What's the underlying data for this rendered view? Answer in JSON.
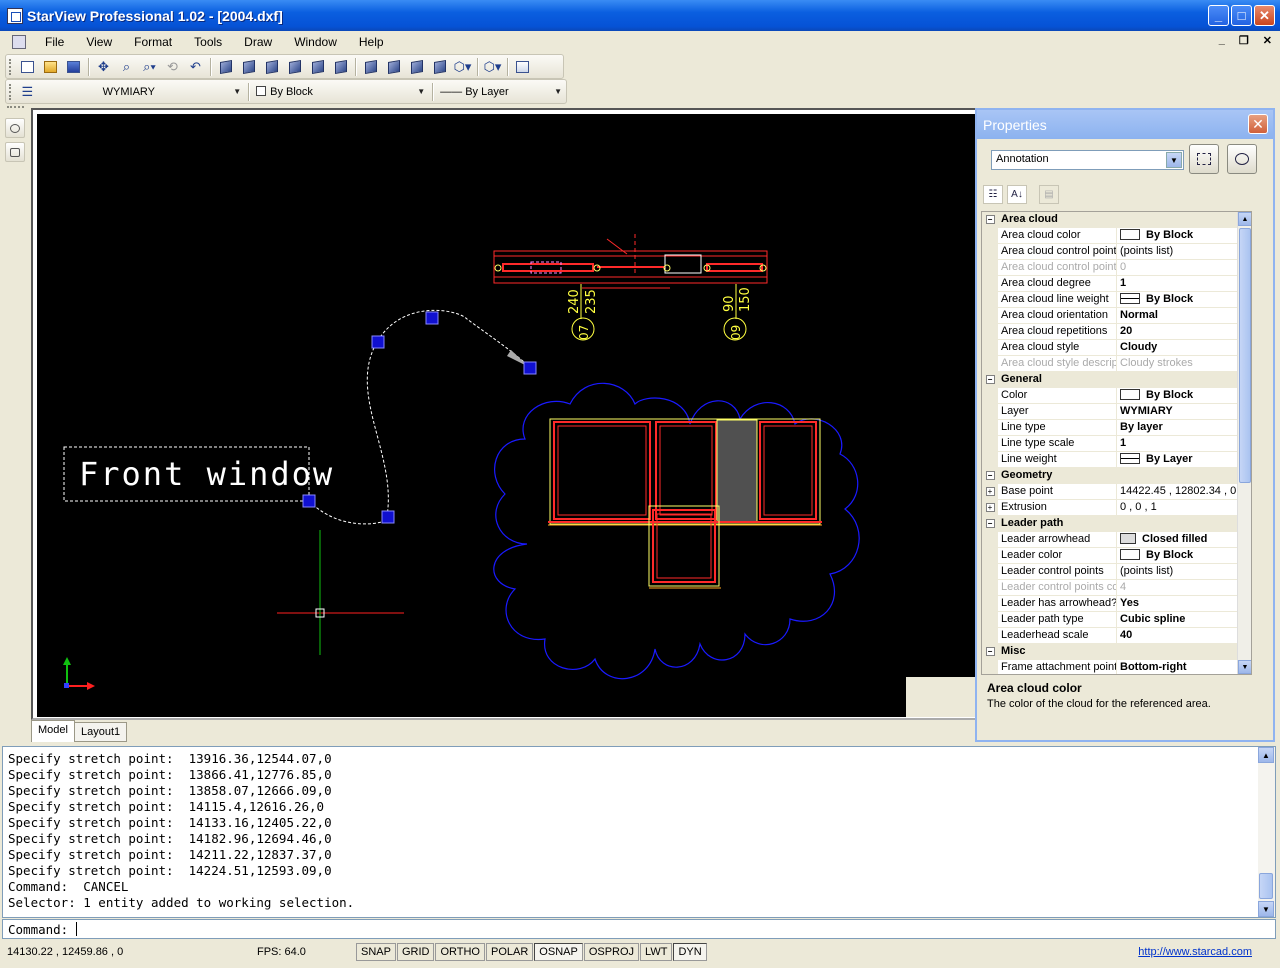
{
  "window": {
    "title": "StarView Professional 1.02 - [2004.dxf]",
    "minimize": "_",
    "maximize": "□",
    "close": "✕",
    "mdi_minimize": "_",
    "mdi_restore": "❐",
    "mdi_close": "✕"
  },
  "menu": [
    "File",
    "View",
    "Format",
    "Tools",
    "Draw",
    "Window",
    "Help"
  ],
  "toolbar2": {
    "layer": "WYMIARY",
    "color": "By Block",
    "linetype": "—— By Layer"
  },
  "canvas": {
    "annotation_text": "Front window",
    "dim_labels": [
      "240",
      "235",
      "07",
      "90",
      "150",
      "09"
    ],
    "colors": {
      "background": "#000000",
      "cloud": "#1a1aff",
      "leader": "#ffffff",
      "grips": "#1010d0",
      "dimension": "#ffff40",
      "window_frame": "#ff2a2a",
      "window_outline": "#ffff66"
    }
  },
  "tabs": [
    "Model",
    "Layout1"
  ],
  "properties": {
    "title": "Properties",
    "selector": "Annotation",
    "categories": [
      {
        "name": "Area cloud",
        "rows": [
          {
            "name": "Area cloud color",
            "value": "By Block",
            "bold": true,
            "swatch": "color"
          },
          {
            "name": "Area cloud control points",
            "value": "(points list)"
          },
          {
            "name": "Area cloud control points",
            "value": "0",
            "disabled": true
          },
          {
            "name": "Area cloud degree",
            "value": "1",
            "bold": true
          },
          {
            "name": "Area cloud line weight",
            "value": "By Block",
            "bold": true,
            "swatch": "lw"
          },
          {
            "name": "Area cloud orientation",
            "value": "Normal",
            "bold": true
          },
          {
            "name": "Area cloud repetitions",
            "value": "20",
            "bold": true
          },
          {
            "name": "Area cloud style",
            "value": "Cloudy",
            "bold": true
          },
          {
            "name": "Area cloud style descript",
            "value": "Cloudy strokes",
            "disabled": true
          }
        ]
      },
      {
        "name": "General",
        "rows": [
          {
            "name": "Color",
            "value": "By Block",
            "bold": true,
            "swatch": "color"
          },
          {
            "name": "Layer",
            "value": "WYMIARY",
            "bold": true
          },
          {
            "name": "Line type",
            "value": "By layer",
            "bold": true
          },
          {
            "name": "Line type scale",
            "value": "1",
            "bold": true
          },
          {
            "name": "Line weight",
            "value": "By Layer",
            "bold": true,
            "swatch": "lw"
          }
        ]
      },
      {
        "name": "Geometry",
        "rows": [
          {
            "name": "Base point",
            "value": "14422.45 , 12802.34 , 0",
            "expand": true
          },
          {
            "name": "Extrusion",
            "value": "0 , 0 , 1",
            "expand": true
          }
        ]
      },
      {
        "name": "Leader path",
        "rows": [
          {
            "name": "Leader arrowhead",
            "value": "Closed filled",
            "bold": true,
            "swatch": "arrow"
          },
          {
            "name": "Leader color",
            "value": "By Block",
            "bold": true,
            "swatch": "color"
          },
          {
            "name": "Leader control points",
            "value": "(points list)"
          },
          {
            "name": "Leader control points cou",
            "value": "4",
            "disabled": true
          },
          {
            "name": "Leader has arrowhead?",
            "value": "Yes",
            "bold": true
          },
          {
            "name": "Leader path type",
            "value": "Cubic spline",
            "bold": true
          },
          {
            "name": "Leaderhead scale",
            "value": "40",
            "bold": true
          }
        ]
      },
      {
        "name": "Misc",
        "rows": [
          {
            "name": "Frame attachment point",
            "value": "Bottom-right",
            "bold": true
          }
        ]
      }
    ],
    "description_title": "Area cloud color",
    "description_text": "The color of the cloud for the referenced area."
  },
  "history": [
    "Specify stretch point:  13916.36,12544.07,0",
    "Specify stretch point:  13866.41,12776.85,0",
    "Specify stretch point:  13858.07,12666.09,0",
    "Specify stretch point:  14115.4,12616.26,0",
    "Specify stretch point:  14133.16,12405.22,0",
    "Specify stretch point:  14182.96,12694.46,0",
    "Specify stretch point:  14211.22,12837.37,0",
    "Specify stretch point:  14224.51,12593.09,0",
    "Command:  CANCEL",
    "Selector: 1 entity added to working selection."
  ],
  "command_prompt": "Command:",
  "status": {
    "coords": "14130.22 , 12459.86 , 0",
    "fps": "FPS: 64.0",
    "buttons": [
      {
        "label": "SNAP",
        "on": false
      },
      {
        "label": "GRID",
        "on": false
      },
      {
        "label": "ORTHO",
        "on": false
      },
      {
        "label": "POLAR",
        "on": false
      },
      {
        "label": "OSNAP",
        "on": true
      },
      {
        "label": "OSPROJ",
        "on": false
      },
      {
        "label": "LWT",
        "on": false
      },
      {
        "label": "DYN",
        "on": true
      }
    ],
    "url": "http://www.starcad.com"
  }
}
